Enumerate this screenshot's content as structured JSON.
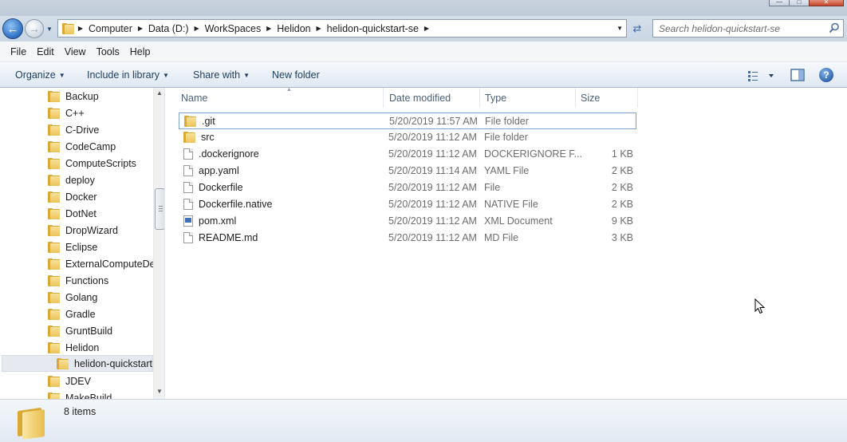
{
  "window": {
    "controls": [
      "minimize",
      "maximize",
      "close"
    ]
  },
  "address_bar": {
    "breadcrumbs": [
      "Computer",
      "Data (D:)",
      "WorkSpaces",
      "Helidon",
      "helidon-quickstart-se"
    ]
  },
  "search": {
    "placeholder": "Search helidon-quickstart-se"
  },
  "menu": {
    "items": [
      "File",
      "Edit",
      "View",
      "Tools",
      "Help"
    ]
  },
  "toolbar": {
    "organize": "Organize",
    "include_in_library": "Include in library",
    "share_with": "Share with",
    "new_folder": "New folder"
  },
  "nav_tree": {
    "items": [
      {
        "label": "Backup"
      },
      {
        "label": "C++"
      },
      {
        "label": "C-Drive"
      },
      {
        "label": "CodeCamp"
      },
      {
        "label": "ComputeScripts"
      },
      {
        "label": "deploy"
      },
      {
        "label": "Docker"
      },
      {
        "label": "DotNet"
      },
      {
        "label": "DropWizard"
      },
      {
        "label": "Eclipse"
      },
      {
        "label": "ExternalComputeDer"
      },
      {
        "label": "Functions"
      },
      {
        "label": "Golang"
      },
      {
        "label": "Gradle"
      },
      {
        "label": "GruntBuild"
      },
      {
        "label": "Helidon"
      },
      {
        "label": "helidon-quickstart",
        "selected": true
      },
      {
        "label": "JDEV"
      },
      {
        "label": "MakeBuild"
      }
    ]
  },
  "file_list": {
    "columns": {
      "name": "Name",
      "date_modified": "Date modified",
      "type": "Type",
      "size": "Size"
    },
    "rows": [
      {
        "name": ".git",
        "date": "5/20/2019 11:57 AM",
        "type": "File folder",
        "size": "",
        "icon": "folder-icon"
      },
      {
        "name": "src",
        "date": "5/20/2019 11:12 AM",
        "type": "File folder",
        "size": "",
        "icon": "folder-icon"
      },
      {
        "name": ".dockerignore",
        "date": "5/20/2019 11:12 AM",
        "type": "DOCKERIGNORE F...",
        "size": "1 KB",
        "icon": "file-icon"
      },
      {
        "name": "app.yaml",
        "date": "5/20/2019 11:14 AM",
        "type": "YAML File",
        "size": "2 KB",
        "icon": "file-icon"
      },
      {
        "name": "Dockerfile",
        "date": "5/20/2019 11:12 AM",
        "type": "File",
        "size": "2 KB",
        "icon": "file-icon"
      },
      {
        "name": "Dockerfile.native",
        "date": "5/20/2019 11:12 AM",
        "type": "NATIVE File",
        "size": "2 KB",
        "icon": "file-icon"
      },
      {
        "name": "pom.xml",
        "date": "5/20/2019 11:12 AM",
        "type": "XML Document",
        "size": "9 KB",
        "icon": "xml-document-icon"
      },
      {
        "name": "README.md",
        "date": "5/20/2019 11:12 AM",
        "type": "MD File",
        "size": "3 KB",
        "icon": "file-icon"
      }
    ]
  },
  "status_bar": {
    "item_count": "8 items"
  },
  "colors": {
    "accent": "#2f6fc3",
    "folder": "#ecc35a",
    "selection": "#e6eaf0"
  }
}
